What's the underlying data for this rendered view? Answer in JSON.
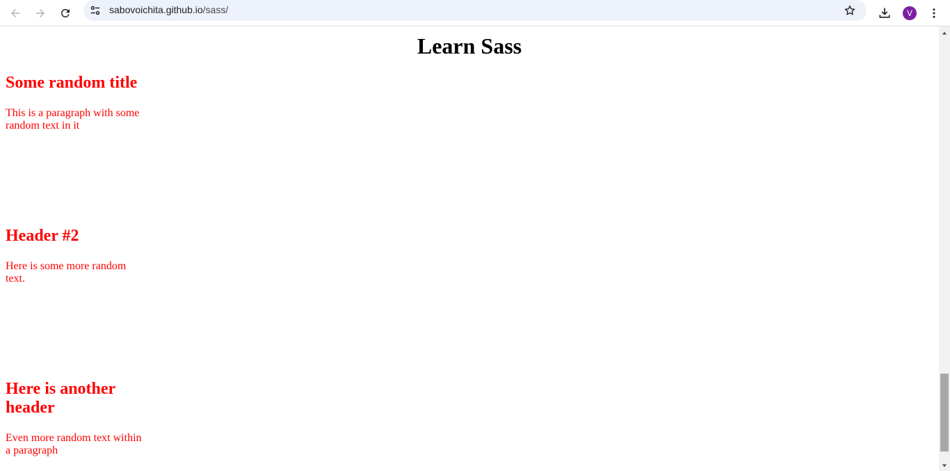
{
  "browser": {
    "url_host": "sabovoichita.github.io",
    "url_path": "/sass/",
    "profile_initial": "V",
    "icons": [
      "back-arrow-icon",
      "forward-arrow-icon",
      "reload-icon",
      "site-settings-icon",
      "bookmark-star-icon",
      "download-icon",
      "kebab-menu-icon"
    ]
  },
  "page": {
    "title": "Learn Sass",
    "text_color": "#ff0000",
    "sections": [
      {
        "heading": "Some random title",
        "text": "This is a paragraph with some random text in it"
      },
      {
        "heading": "Header #2",
        "text": "Here is some more random text."
      },
      {
        "heading": "Here is another header",
        "text": "Even more random text within a paragraph"
      }
    ]
  }
}
